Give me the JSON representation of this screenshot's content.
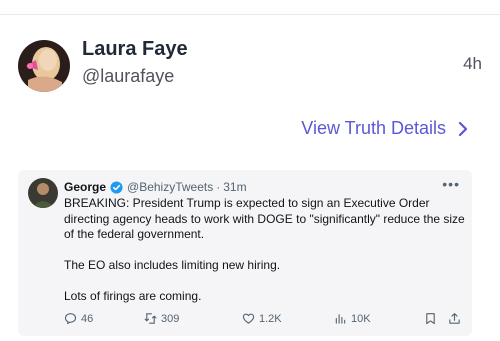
{
  "post": {
    "author_name": "Laura Faye",
    "author_handle": "@laurafaye",
    "time_ago": "4h"
  },
  "details_link": {
    "label": "View Truth Details"
  },
  "embedded_tweet": {
    "user_name": "George",
    "user_handle": "@BehizyTweets",
    "time_ago": "31m",
    "separator": "·",
    "paragraphs": [
      "BREAKING: President Trump is expected to sign an Executive Order directing agency heads to work with DOGE to \"significantly\" reduce the size of the federal government.",
      "The EO also includes limiting new hiring.",
      "Lots of firings are coming."
    ],
    "stats": {
      "replies": "46",
      "retweets": "309",
      "likes": "1.2K",
      "views": "10K"
    }
  },
  "colors": {
    "accent": "#5b58d6",
    "verified": "#1d9bf0",
    "embed_bg": "#f5f5f8"
  }
}
